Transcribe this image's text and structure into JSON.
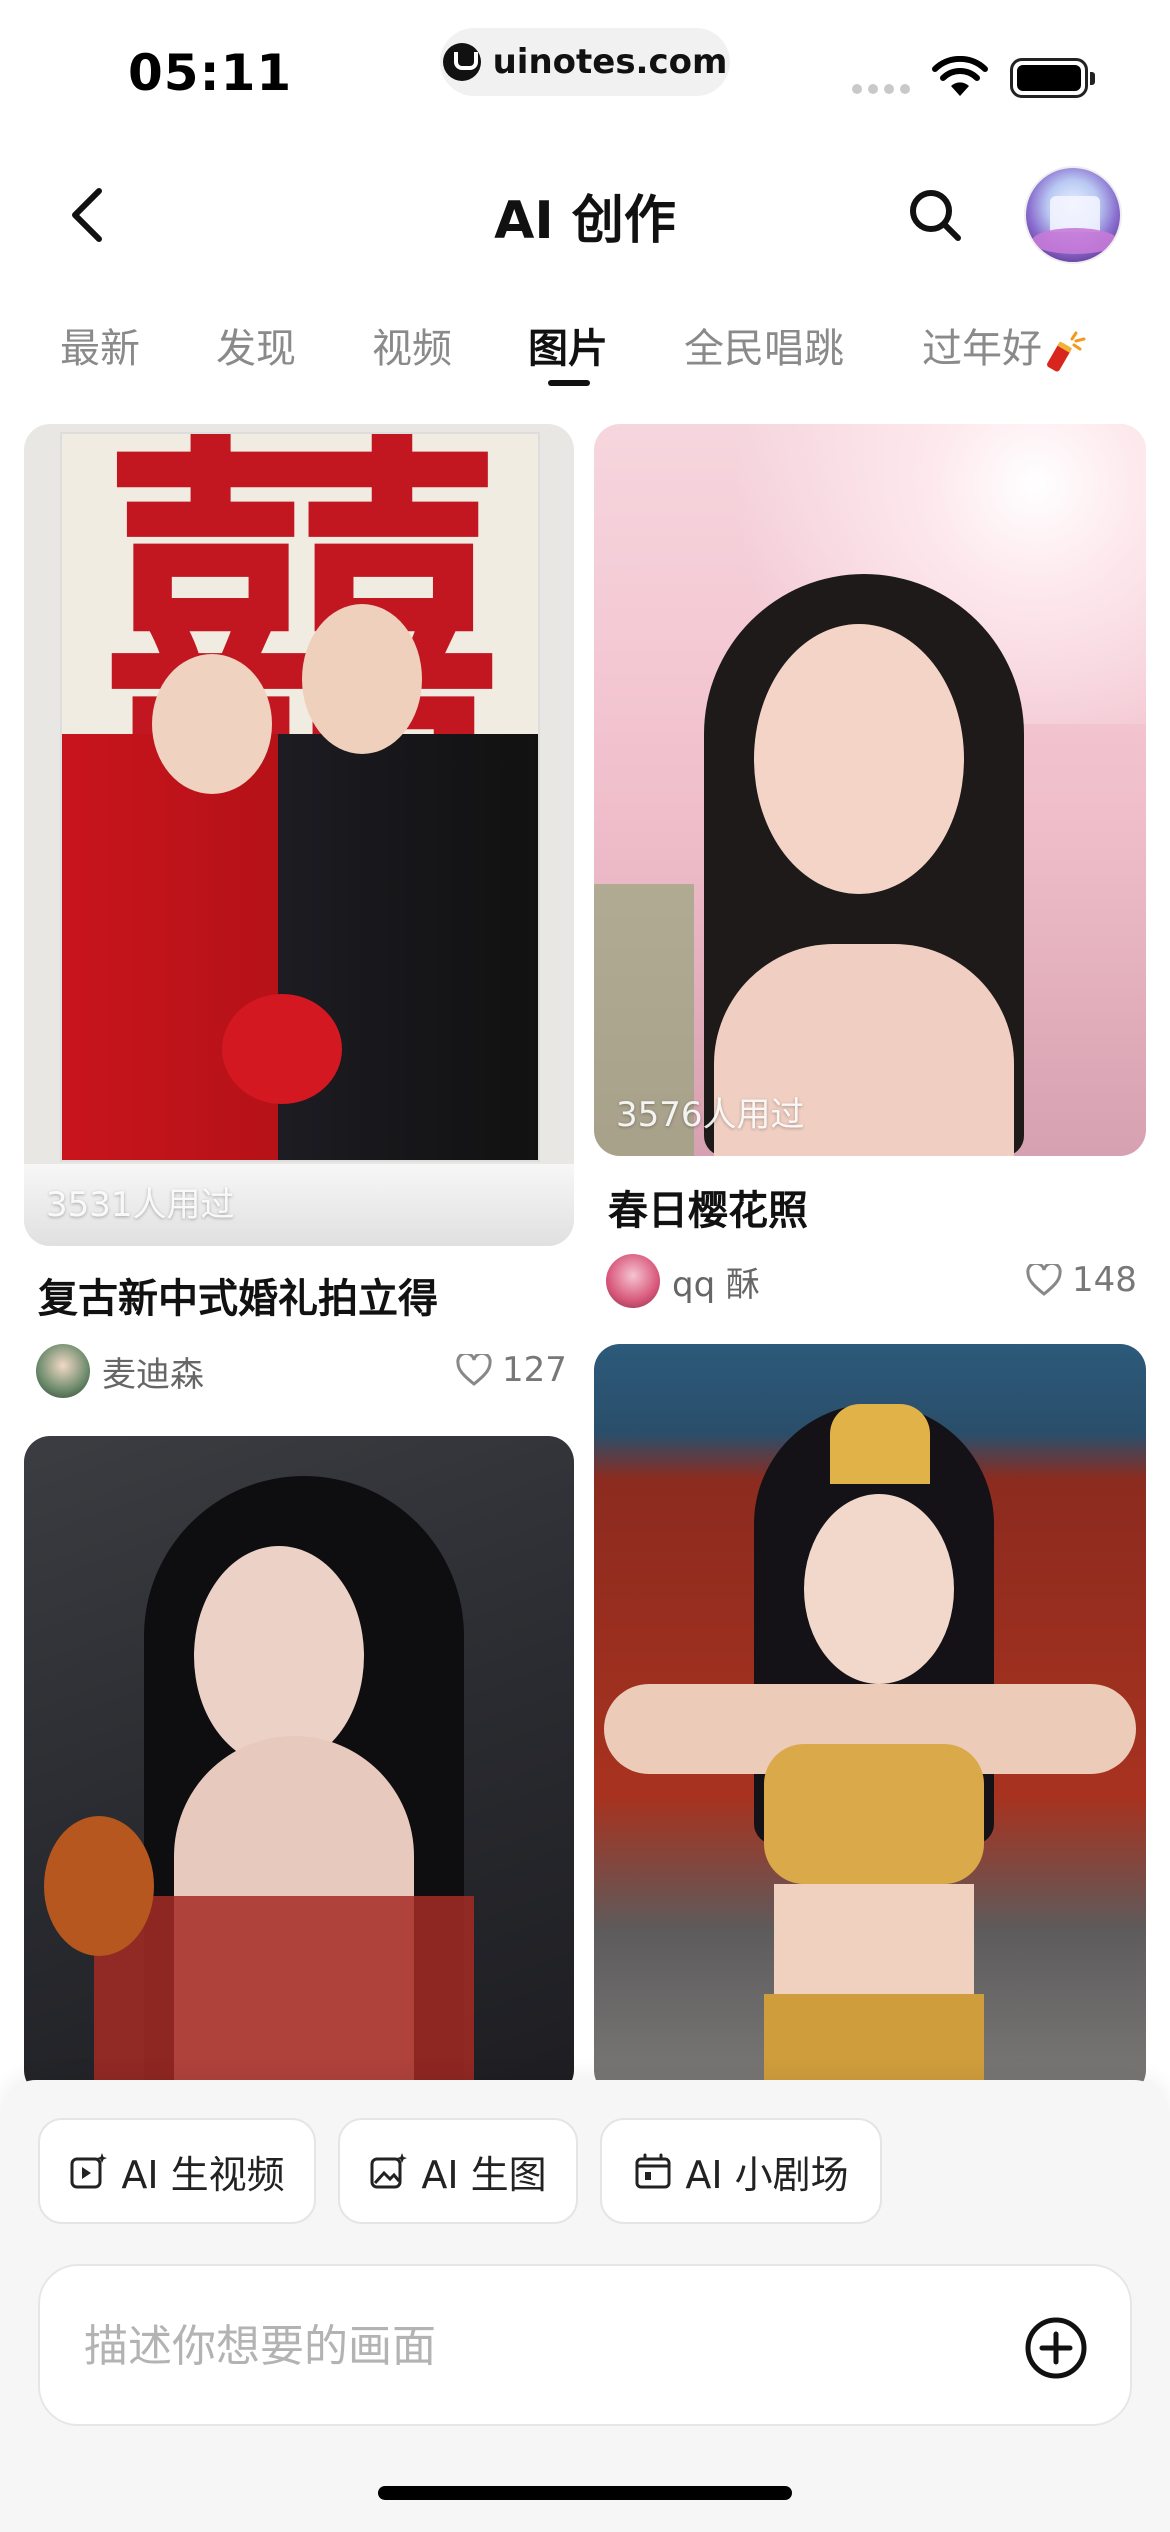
{
  "status_bar": {
    "time": "05:11",
    "url": "uinotes.com"
  },
  "header": {
    "title": "AI 创作"
  },
  "tabs": [
    {
      "label": "最新"
    },
    {
      "label": "发现"
    },
    {
      "label": "视频"
    },
    {
      "label": "图片",
      "active": true
    },
    {
      "label": "全民唱跳"
    },
    {
      "label": "过年好"
    }
  ],
  "feed": {
    "cards": [
      {
        "title": "复古新中式婚礼拍立得",
        "uses": "3531人用过",
        "author": "麦迪森",
        "likes": "127",
        "image_watermark": "囍"
      },
      {
        "title": "春日樱花照",
        "uses": "3576人用过",
        "author": "qq 酥",
        "likes": "148"
      },
      {
        "title": "",
        "uses": "",
        "author": "",
        "likes": ""
      },
      {
        "title": "",
        "uses": "",
        "author": "",
        "likes": ""
      }
    ]
  },
  "bottom": {
    "actions": [
      {
        "label": "AI 生视频",
        "icon": "video-sparkle-icon"
      },
      {
        "label": "AI 生图",
        "icon": "image-sparkle-icon"
      },
      {
        "label": "AI 小剧场",
        "icon": "theater-icon"
      }
    ],
    "input_placeholder": "描述你想要的画面"
  },
  "colors": {
    "accent_red": "#c21620",
    "text_primary": "#111111",
    "text_secondary": "#8a8a8a",
    "panel_bg": "#f6f6f7"
  }
}
